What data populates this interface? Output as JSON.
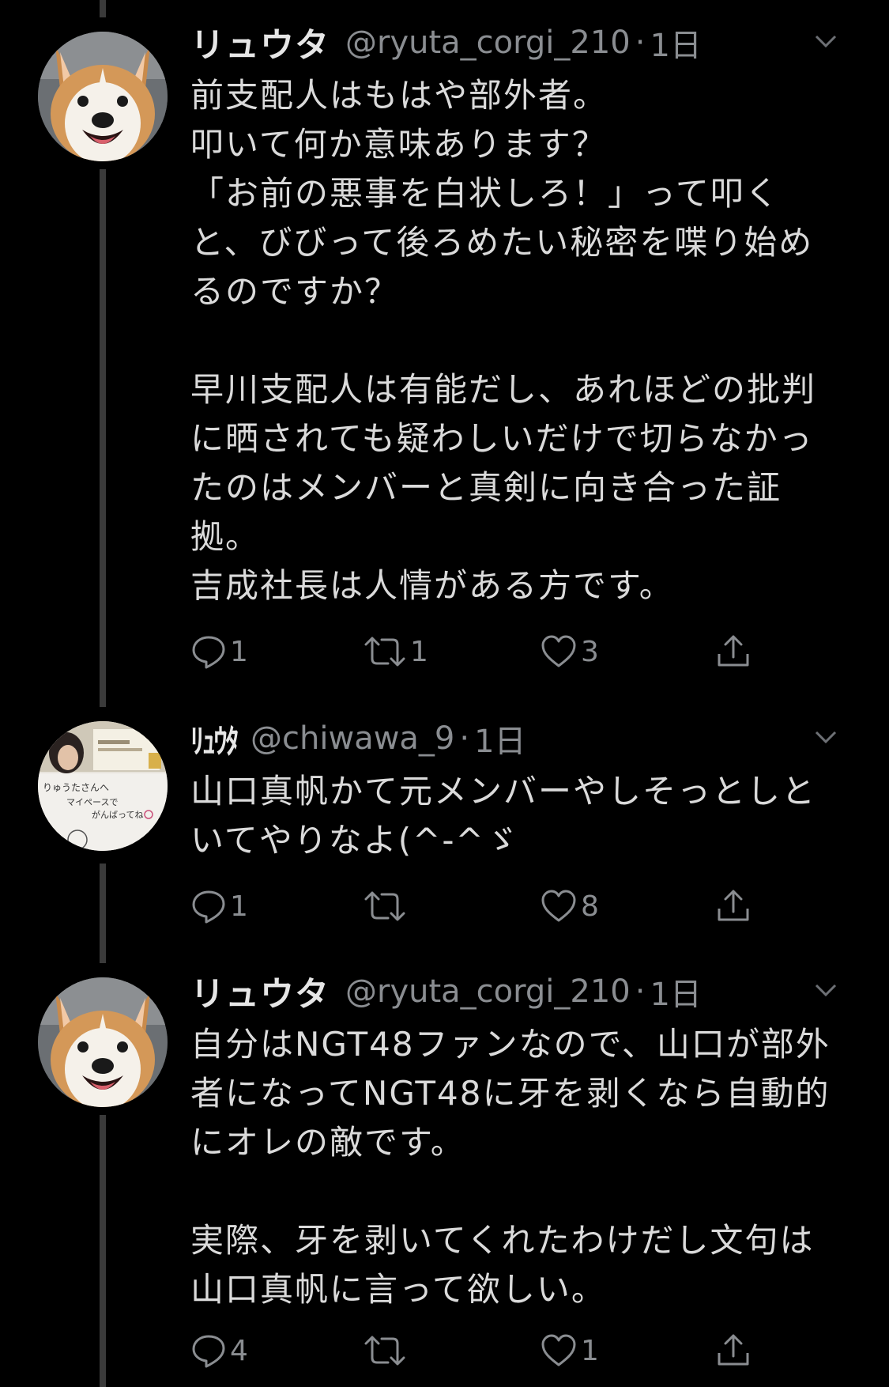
{
  "tweets": [
    {
      "name": "リュウタ",
      "handle": "@ryuta_corgi_210",
      "sep": "·",
      "time": "1日",
      "lines": [
        "前支配人はもはや部外者。",
        "叩いて何か意味あります？",
        "「お前の悪事を白状しろ！」って叩く",
        "と、びびって後ろめたい秘密を喋り始め",
        "るのですか？",
        "",
        "早川支配人は有能だし、あれほどの批判",
        "に晒されても疑わしいだけで切らなかっ",
        "たのはメンバーと真剣に向き合った証",
        "拠。",
        "吉成社長は人情がある方です。"
      ],
      "replies": "1",
      "retweets": "1",
      "likes": "3"
    },
    {
      "name": "ﾘｭｳﾀ",
      "handle": "@chiwawa_9",
      "sep": "·",
      "time": "1日",
      "avatar_text": [
        "りゅうたさんへ",
        "マイペースで",
        "がんばってね"
      ],
      "lines": [
        "山口真帆かて元メンバーやしそっとしと",
        "いてやりなよ(^-^ゞ"
      ],
      "replies": "1",
      "retweets": "",
      "likes": "8"
    },
    {
      "name": "リュウタ",
      "handle": "@ryuta_corgi_210",
      "sep": "·",
      "time": "1日",
      "lines": [
        "自分はNGT48ファンなので、山口が部外",
        "者になってNGT48に牙を剥くなら自動的",
        "にオレの敵です。",
        "",
        "実際、牙を剥いてくれたわけだし文句は",
        "山口真帆に言って欲しい。"
      ],
      "replies": "4",
      "retweets": "",
      "likes": "1"
    }
  ],
  "icons": {
    "reply": "reply-icon",
    "retweet": "retweet-icon",
    "like": "heart-icon",
    "share": "share-icon",
    "more": "chevron-down-icon"
  },
  "colors": {
    "background": "#000000",
    "text": "#d9d9d9",
    "secondary": "#8a8d91",
    "thread_line": "#3a3a3a"
  }
}
